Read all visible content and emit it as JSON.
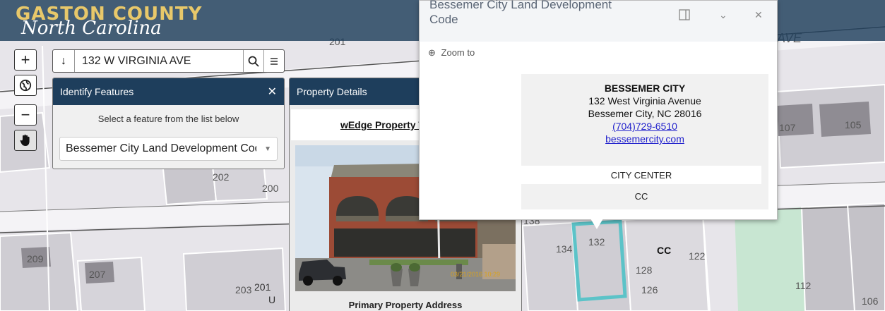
{
  "logo": {
    "line1": "GASTON COUNTY",
    "line2": "North Carolina"
  },
  "map_controls": {
    "zoom_in": "+",
    "globe": "globe-icon",
    "zoom_out": "−",
    "pan": "hand-icon"
  },
  "search": {
    "value": "132 W VIRGINIA AVE",
    "arrow": "↓"
  },
  "identify": {
    "title": "Identify Features",
    "hint": "Select a feature from the list below",
    "selected": "Bessemer City Land Development Cod"
  },
  "property": {
    "title": "Property Details",
    "link": "wEdge Property Tax Inquiry",
    "photo_timestamp": "03/21/2016 10:29",
    "address_label": "Primary Property Address"
  },
  "popup": {
    "title_line1": "Bessemer City Land Development",
    "title_line2": "Code",
    "zoom_label": "Zoom to",
    "name": "BESSEMER CITY",
    "street": "132 West Virginia Avenue",
    "city": "Bessemer City, NC 28016",
    "phone": "(704)729-6510",
    "website": "bessemercity.com",
    "district_name": "CITY CENTER",
    "district_code": "CC"
  },
  "map_labels": {
    "parcels": [
      "201",
      "202",
      "200",
      "209",
      "207",
      "203",
      "201",
      "138",
      "134",
      "132",
      "128",
      "126",
      "122",
      "107",
      "105",
      "112",
      "106"
    ],
    "zone": "CC",
    "street": "AVE",
    "u": "U"
  }
}
